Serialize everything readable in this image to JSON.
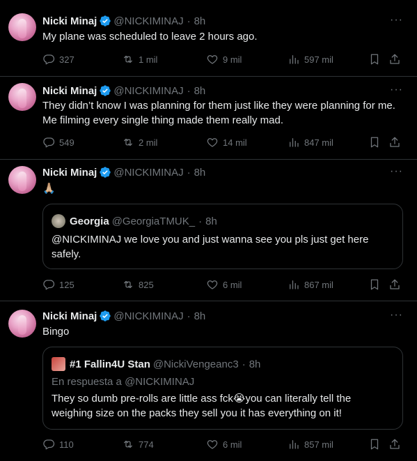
{
  "colors": {
    "background": "#000000",
    "text": "#e7e9ea",
    "muted": "#71767b",
    "verified": "#1d9bf0",
    "border": "#2f3336"
  },
  "tweets": [
    {
      "name": "Nicki Minaj",
      "handle": "@NICKIMINAJ",
      "time": "8h",
      "text": "My plane was scheduled to leave 2 hours ago.",
      "replies": "327",
      "retweets": "1 mil",
      "likes": "9 mil",
      "views": "597 mil"
    },
    {
      "name": "Nicki Minaj",
      "handle": "@NICKIMINAJ",
      "time": "8h",
      "text": "They didn’t know I was planning for them just like they were planning for me. Me filming every single thing made them really mad.",
      "replies": "549",
      "retweets": "2 mil",
      "likes": "14 mil",
      "views": "847 mil"
    },
    {
      "name": "Nicki Minaj",
      "handle": "@NICKIMINAJ",
      "time": "8h",
      "text": "🙏🏼",
      "quote": {
        "name": "Georgia",
        "handle": "@GeorgiaTMUK_",
        "time": "8h",
        "text": "@NICKIMINAJ we love you and just wanna see you pls just get here safely."
      },
      "replies": "125",
      "retweets": "825",
      "likes": "6 mil",
      "views": "867 mil"
    },
    {
      "name": "Nicki Minaj",
      "handle": "@NICKIMINAJ",
      "time": "8h",
      "text": "Bingo",
      "quote": {
        "name": "#1 Fallin4U Stan",
        "handle": "@NickiVengeanc3",
        "time": "8h",
        "reply_to": "En respuesta a @NICKIMINAJ",
        "text": "They so dumb pre-rolls are little ass fck😭you can literally tell the weighing size on the packs they sell you it has everything on it!"
      },
      "replies": "110",
      "retweets": "774",
      "likes": "6 mil",
      "views": "857 mil"
    }
  ],
  "icons": [
    "verified-icon",
    "more-icon",
    "reply-icon",
    "retweet-icon",
    "like-icon",
    "views-icon",
    "bookmark-icon",
    "share-icon"
  ]
}
